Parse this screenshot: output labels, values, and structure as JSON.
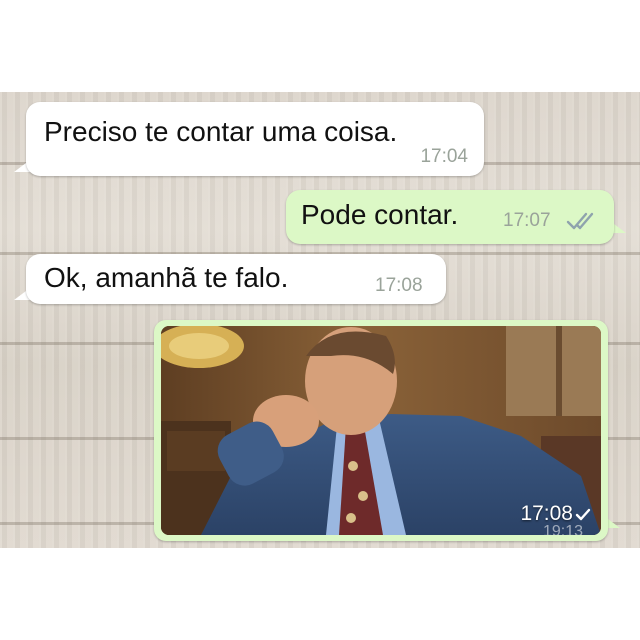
{
  "messages": [
    {
      "text": "Preciso te contar uma coisa.",
      "time": "17:04"
    },
    {
      "text": "Pode contar.",
      "time": "17:07",
      "status_icon": "double-check-icon"
    },
    {
      "text": "Ok, amanhã te falo.",
      "time": "17:08"
    }
  ],
  "image_message": {
    "time": "17:08",
    "status_icon": "single-check-icon",
    "overlay_time": "19:13",
    "photo": "man-biting-fist-photo"
  },
  "colors": {
    "incoming_bubble": "#ffffff",
    "outgoing_bubble": "#dcf8c6",
    "timestamp": "#9aa39a",
    "read_ticks": "#8fa3ad"
  }
}
